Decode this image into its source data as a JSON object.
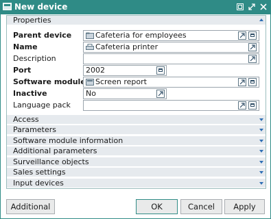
{
  "window": {
    "title": "New device"
  },
  "sections": {
    "properties": "Properties",
    "collapsed": [
      "Access",
      "Parameters",
      "Software module information",
      "Additional parameters",
      "Surveillance objects",
      "Sales settings",
      "Input devices"
    ]
  },
  "fields": {
    "parent_device": {
      "label": "Parent device",
      "value": "Cafeteria for employees"
    },
    "name": {
      "label": "Name",
      "value": "Cafeteria printer"
    },
    "description": {
      "label": "Description",
      "value": ""
    },
    "port": {
      "label": "Port",
      "value": "2002"
    },
    "software_module": {
      "label": "Software module",
      "value": "Screen report"
    },
    "inactive": {
      "label": "Inactive",
      "value": "No"
    },
    "language_pack": {
      "label": "Language pack",
      "value": ""
    }
  },
  "buttons": {
    "additional": "Additional",
    "ok": "OK",
    "cancel": "Cancel",
    "apply": "Apply"
  },
  "colors": {
    "accent": "#2f8b86",
    "section_bg": "#e6eaee",
    "arrow": "#2f6fb5"
  }
}
